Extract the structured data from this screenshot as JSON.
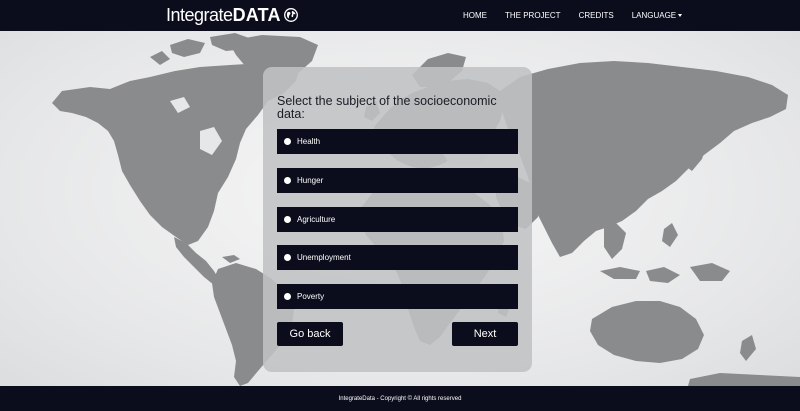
{
  "navbar": {
    "brand_light": "Integrate",
    "brand_bold": "DATA",
    "links": [
      "HOME",
      "THE PROJECT",
      "CREDITS"
    ],
    "language_label": "LANGUAGE"
  },
  "form": {
    "question": "Select the subject of the socioeconomic data:",
    "options": [
      "Health",
      "Hunger",
      "Agriculture",
      "Unemployment",
      "Poverty"
    ],
    "back_label": "Go back",
    "next_label": "Next"
  },
  "footer": {
    "text": "IntegrateData - Copyright © All rights reserved"
  },
  "colors": {
    "dark": "#0b0d1c",
    "map_land": "#8a8b8d",
    "card": "#c0c1c3"
  }
}
